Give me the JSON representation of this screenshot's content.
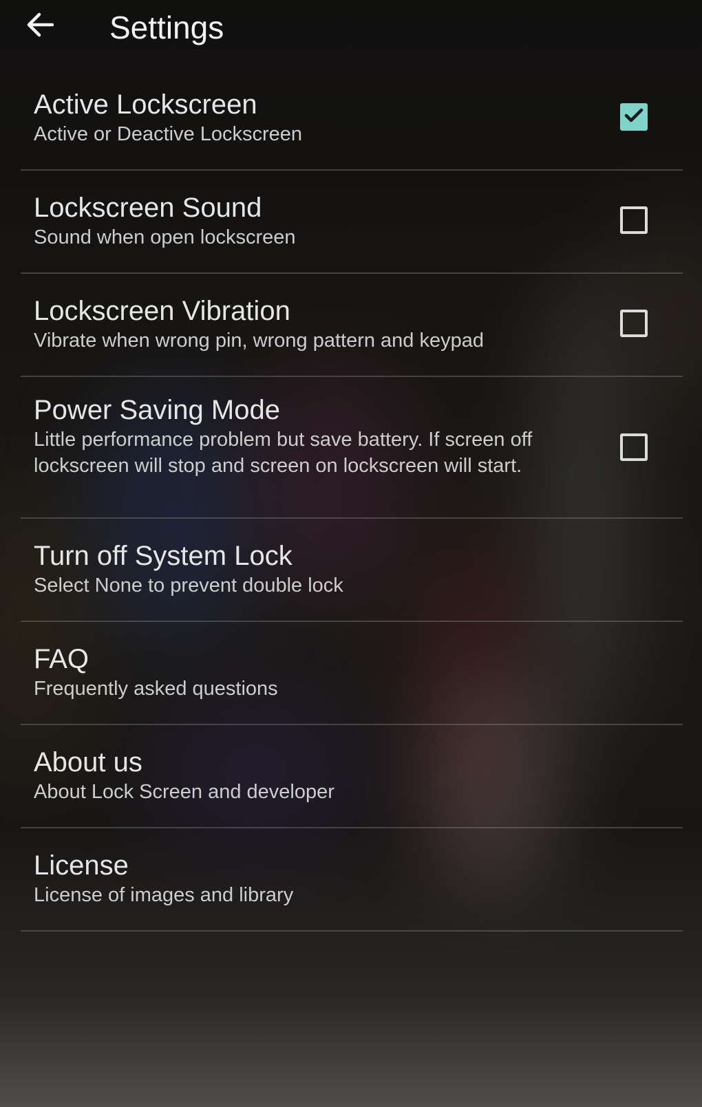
{
  "colors": {
    "accent": "#7fd3c9",
    "text_primary": "#e6e6e6",
    "text_secondary": "#cdcdcd",
    "divider": "#5a5a5a"
  },
  "toolbar": {
    "back_icon": "arrow-left-icon",
    "title": "Settings"
  },
  "settings": {
    "items": [
      {
        "title": "Active Lockscreen",
        "subtitle": "Active or Deactive Lockscreen",
        "has_checkbox": true,
        "checked": true
      },
      {
        "title": "Lockscreen Sound",
        "subtitle": "Sound when open lockscreen",
        "has_checkbox": true,
        "checked": false
      },
      {
        "title": "Lockscreen Vibration",
        "subtitle": "Vibrate when wrong pin, wrong pattern and keypad",
        "has_checkbox": true,
        "checked": false
      },
      {
        "title": "Power Saving Mode",
        "subtitle": "Little performance problem but save battery. If screen off lockscreen will stop and screen on lockscreen will start.",
        "has_checkbox": true,
        "checked": false
      },
      {
        "title": "Turn off System Lock",
        "subtitle": "Select None to prevent double lock",
        "has_checkbox": false
      },
      {
        "title": "FAQ",
        "subtitle": "Frequently asked questions",
        "has_checkbox": false
      },
      {
        "title": "About us",
        "subtitle": "About Lock Screen and developer",
        "has_checkbox": false
      },
      {
        "title": "License",
        "subtitle": "License of images and library",
        "has_checkbox": false
      }
    ]
  }
}
